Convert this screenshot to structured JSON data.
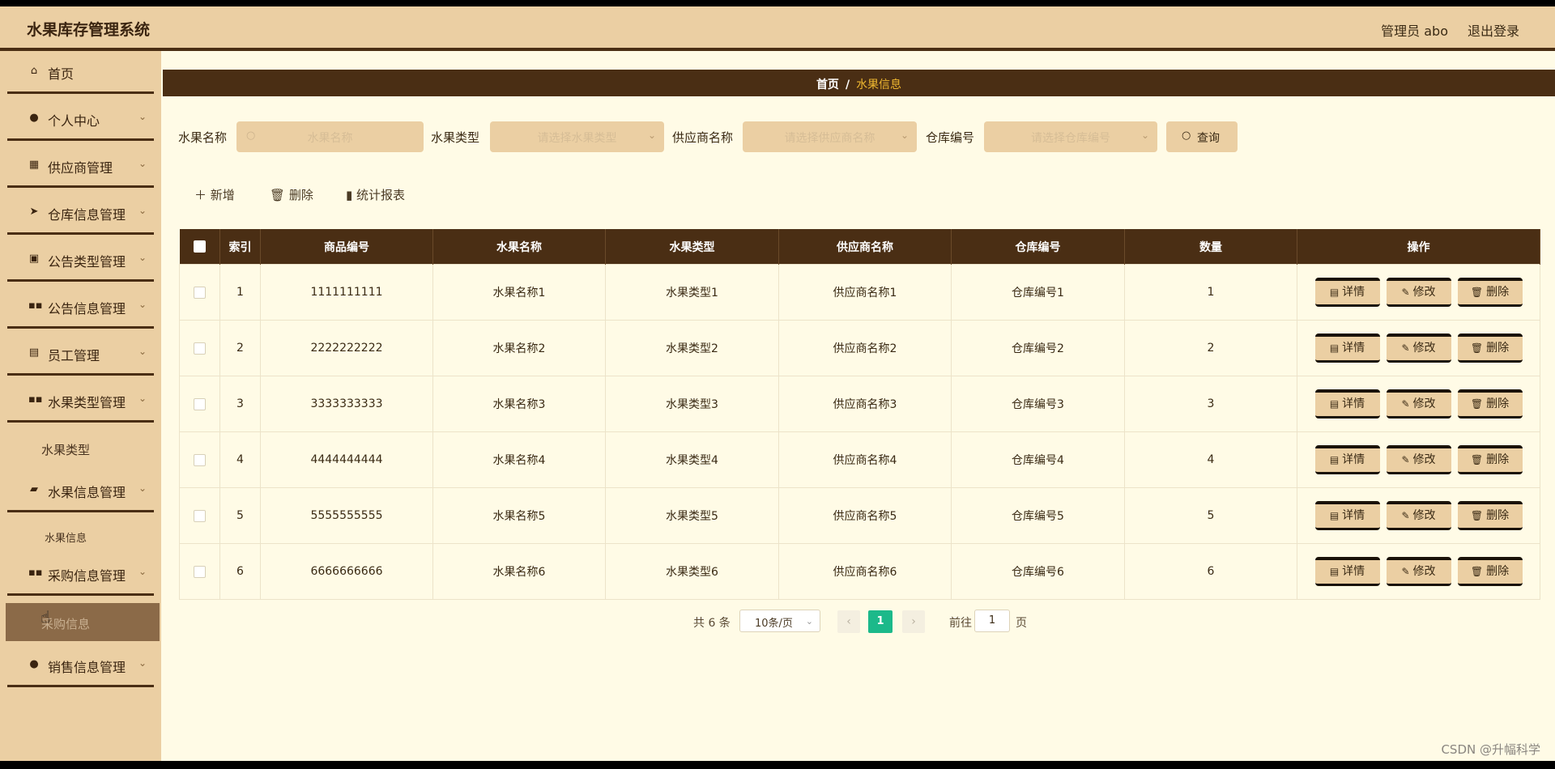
{
  "header": {
    "app_title": "水果库存管理系统",
    "admin_label": "管理员 abo",
    "logout_label": "退出登录"
  },
  "sidebar": {
    "items": [
      {
        "label": "首页",
        "icon": "home-icon"
      },
      {
        "label": "个人中心",
        "icon": "user-icon"
      },
      {
        "label": "供应商管理",
        "icon": "grid-icon"
      },
      {
        "label": "仓库信息管理",
        "icon": "send-icon"
      },
      {
        "label": "公告类型管理",
        "icon": "clipboard-icon"
      },
      {
        "label": "公告信息管理",
        "icon": "apps-icon"
      },
      {
        "label": "员工管理",
        "icon": "badge-icon"
      },
      {
        "label": "水果类型管理",
        "icon": "apps-icon"
      },
      {
        "label": "水果信息管理",
        "icon": "ticket-icon"
      },
      {
        "label": "采购信息管理",
        "icon": "apps-icon"
      },
      {
        "label": "销售信息管理",
        "icon": "user-icon"
      }
    ],
    "sub_items": {
      "fruit_type": "水果类型",
      "fruit_info": "水果信息",
      "purchase_info": "采购信息"
    }
  },
  "breadcrumb": {
    "home": "首页",
    "separator": "/",
    "current": "水果信息"
  },
  "filters": {
    "fruit_name": {
      "label": "水果名称",
      "placeholder": "水果名称"
    },
    "fruit_type": {
      "label": "水果类型",
      "placeholder": "请选择水果类型"
    },
    "supplier": {
      "label": "供应商名称",
      "placeholder": "请选择供应商名称"
    },
    "warehouse": {
      "label": "仓库编号",
      "placeholder": "请选择仓库编号"
    },
    "query_label": "查询"
  },
  "toolbar": {
    "add_label": "新增",
    "delete_label": "删除",
    "report_label": "统计报表"
  },
  "table": {
    "columns": [
      "索引",
      "商品编号",
      "水果名称",
      "水果类型",
      "供应商名称",
      "仓库编号",
      "数量",
      "操作"
    ],
    "rows": [
      [
        "1",
        "1111111111",
        "水果名称1",
        "水果类型1",
        "供应商名称1",
        "仓库编号1",
        "1"
      ],
      [
        "2",
        "2222222222",
        "水果名称2",
        "水果类型2",
        "供应商名称2",
        "仓库编号2",
        "2"
      ],
      [
        "3",
        "3333333333",
        "水果名称3",
        "水果类型3",
        "供应商名称3",
        "仓库编号3",
        "3"
      ],
      [
        "4",
        "4444444444",
        "水果名称4",
        "水果类型4",
        "供应商名称4",
        "仓库编号4",
        "4"
      ],
      [
        "5",
        "5555555555",
        "水果名称5",
        "水果类型5",
        "供应商名称5",
        "仓库编号5",
        "5"
      ],
      [
        "6",
        "6666666666",
        "水果名称6",
        "水果类型6",
        "供应商名称6",
        "仓库编号6",
        "6"
      ]
    ],
    "actions": {
      "detail": "详情",
      "edit": "修改",
      "delete": "删除"
    }
  },
  "pagination": {
    "total": "共 6 条",
    "page_size": "10条/页",
    "current_page": "1",
    "goto_prefix": "前往",
    "goto_value": "1",
    "goto_suffix": "页"
  },
  "watermark": "CSDN @升幅科学"
}
